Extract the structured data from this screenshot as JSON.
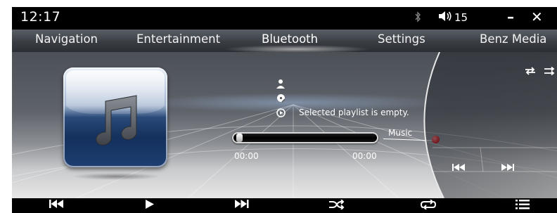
{
  "status": {
    "time": "12:17",
    "bluetooth_icon": "bluetooth-icon",
    "volume_icon": "speaker-icon",
    "volume": "15",
    "minimize_symbol": "–",
    "close_symbol": "✕"
  },
  "tabs": [
    {
      "label": "Navigation"
    },
    {
      "label": "Entertainment"
    },
    {
      "label": "Bluetooth",
      "active": true
    },
    {
      "label": "Settings"
    },
    {
      "label": "Benz Media"
    }
  ],
  "player": {
    "album_art_icon": "music-note-icon",
    "artist_icon": "person-icon",
    "album_icon": "album-icon",
    "playlist_icon": "play-circle-icon",
    "message": "Selected playlist is empty.",
    "elapsed": "00:00",
    "total": "00:00",
    "progress": 0,
    "source_label": "Music",
    "marker_color": "#e0101a"
  },
  "arc_panel": {
    "repeat_icon": "repeat-icon",
    "shuffle_icon": "shuffle-icon",
    "prev_icon": "skip-previous-icon",
    "next_icon": "skip-next-icon"
  },
  "toolbar": [
    {
      "icon": "skip-previous-icon"
    },
    {
      "icon": "play-icon"
    },
    {
      "icon": "skip-next-icon"
    },
    {
      "icon": "shuffle-icon"
    },
    {
      "icon": "repeat-icon"
    },
    {
      "icon": "list-icon"
    }
  ],
  "colors": {
    "accent_red": "#e0101a",
    "nav_bar": "#3a3e44"
  }
}
